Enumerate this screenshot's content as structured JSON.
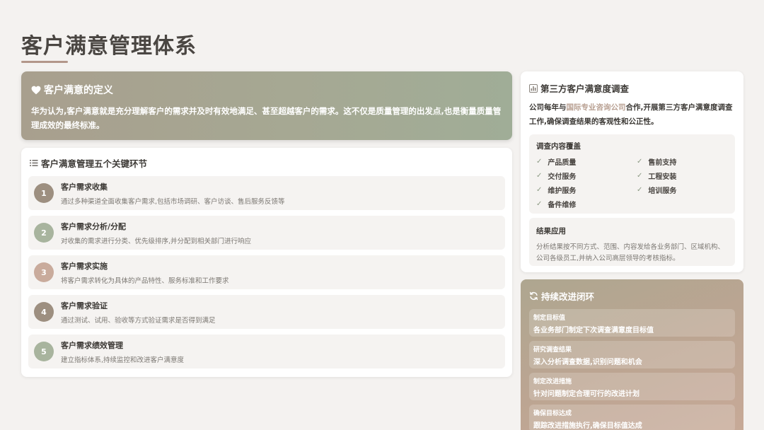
{
  "page_title": "客户满意管理体系",
  "definition": {
    "title": "客户满意的定义",
    "icon": "heart-icon",
    "text": "华为认为,客户满意就是充分理解客户的需求并及时有效地满足、甚至超越客户的需求。这不仅是质量管理的出发点,也是衡量质量管理成效的最终标准。"
  },
  "steps": {
    "title": "客户满意管理五个关键环节",
    "icon": "list-icon",
    "items": [
      {
        "num": "1",
        "title": "客户需求收集",
        "desc": "通过多种渠道全面收集客户需求,包括市场调研、客户访谈、售后服务反馈等",
        "color": "#9d8f80"
      },
      {
        "num": "2",
        "title": "客户需求分析/分配",
        "desc": "对收集的需求进行分类、优先级排序,并分配到相关部门进行响应",
        "color": "#a8b49e"
      },
      {
        "num": "3",
        "title": "客户需求实施",
        "desc": "将客户需求转化为具体的产品特性、服务标准和工作要求",
        "color": "#c9ab9c"
      },
      {
        "num": "4",
        "title": "客户需求验证",
        "desc": "通过测试、试用、验收等方式验证需求是否得到满足",
        "color": "#9d8f80"
      },
      {
        "num": "5",
        "title": "客户需求绩效管理",
        "desc": "建立指标体系,持续监控和改进客户满意度",
        "color": "#a8b49e"
      }
    ]
  },
  "survey": {
    "title": "第三方客户满意度调查",
    "icon": "chart-icon",
    "text_before": "公司每年与",
    "text_highlight": "国际专业咨询公司",
    "text_after": "合作,开展第三方客户满意度调查工作,确保调查结果的客观性和公正性。",
    "coverage_title": "调查内容覆盖",
    "coverage_items": [
      "产品质量",
      "售前支持",
      "交付服务",
      "工程安装",
      "维护服务",
      "培训服务",
      "备件维修"
    ],
    "result_title": "结果应用",
    "result_text": "分析结果按不同方式、范围、内容发给各业务部门、区域机构、公司各级员工,并纳入公司高层领导的考核指标。"
  },
  "improve": {
    "title": "持续改进闭环",
    "icon": "refresh-icon",
    "items": [
      {
        "label": "制定目标值",
        "text": "各业务部门制定下次调查满意度目标值"
      },
      {
        "label": "研究调查结果",
        "text": "深入分析调查数据,识别问题和机会"
      },
      {
        "label": "制定改进措施",
        "text": "针对问题制定合理可行的改进计划"
      },
      {
        "label": "确保目标达成",
        "text": "跟踪改进措施执行,确保目标值达成"
      }
    ]
  }
}
